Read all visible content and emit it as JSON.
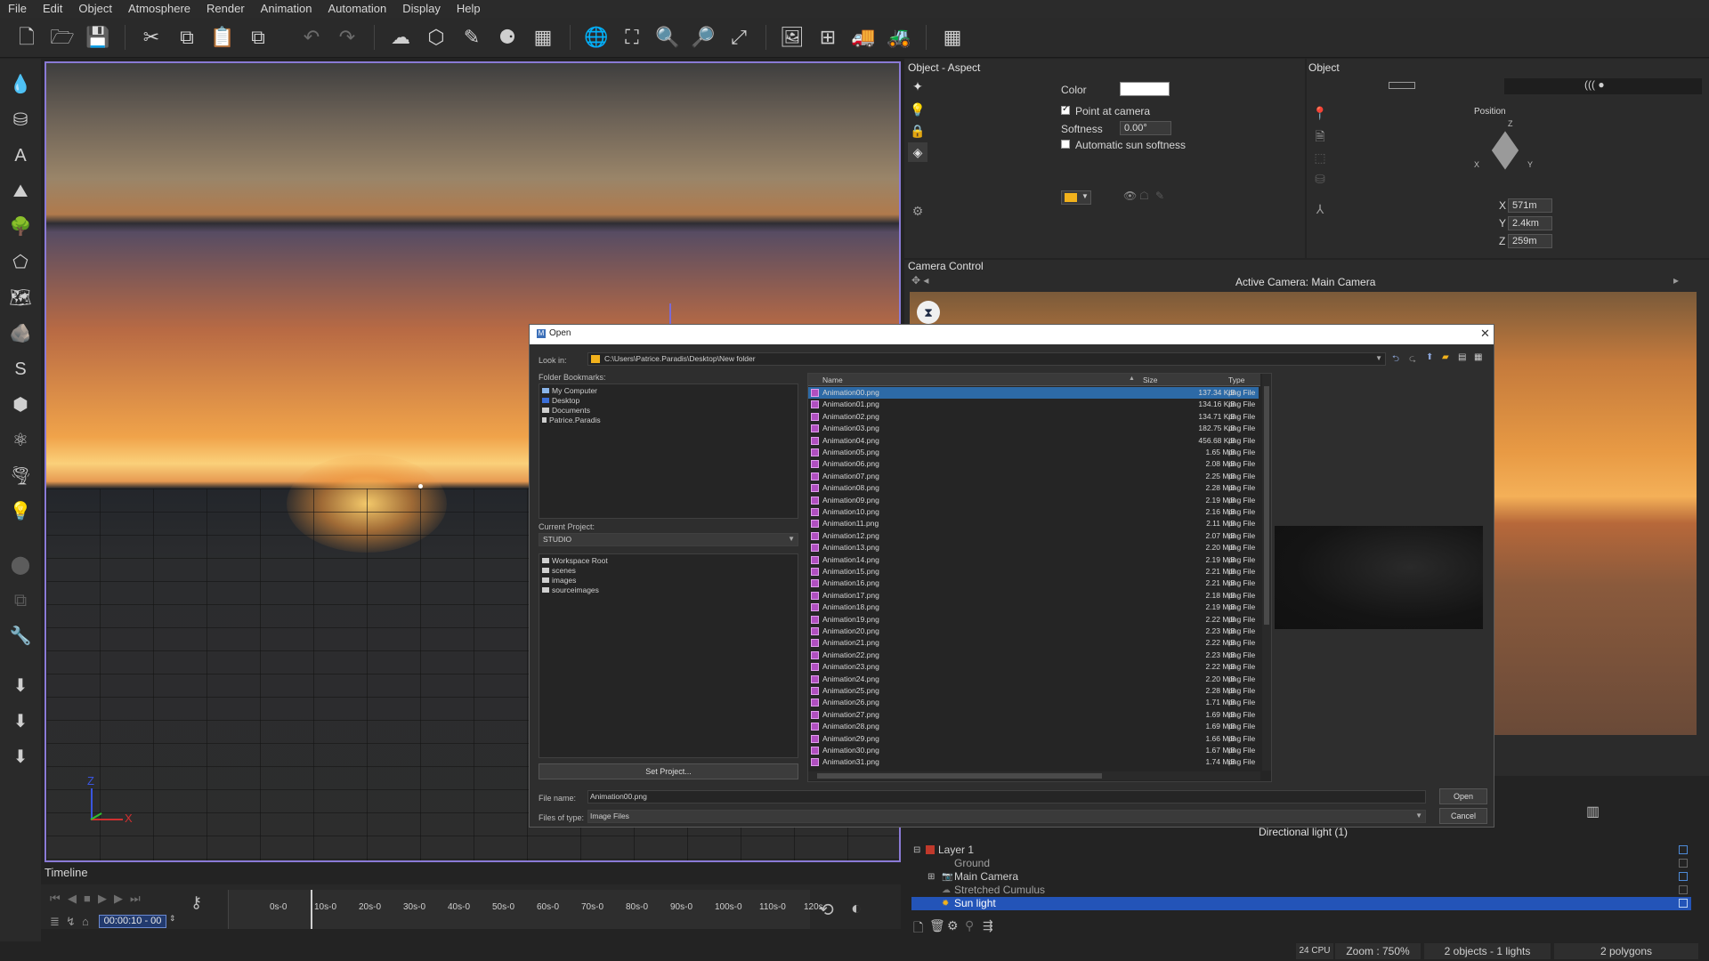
{
  "menu": [
    "File",
    "Edit",
    "Object",
    "Atmosphere",
    "Render",
    "Animation",
    "Automation",
    "Display",
    "Help"
  ],
  "toolbar": {
    "icons": [
      "new-file-icon",
      "open-file-icon",
      "save-icon",
      "cut-icon",
      "copy-icon",
      "paste-icon",
      "duplicate-icon",
      "undo-icon",
      "redo-icon",
      "atmosphere-icon",
      "object-icon",
      "plant-icon",
      "material-icon",
      "grid-icon",
      "globe-icon",
      "fit-icon",
      "zoom-in-icon",
      "zoom-out-icon",
      "maximize-icon",
      "render-area-icon",
      "render-frame-icon",
      "npr-icon",
      "render-icon",
      "layout-icon"
    ],
    "glyphs": [
      "🗋",
      "🗁",
      "💾",
      "✂",
      "⧉",
      "📋",
      "⧉",
      "↶",
      "↷",
      "☁",
      "⬡",
      "✎",
      "⚈",
      "▦",
      "🌐",
      "⛶",
      "🔍",
      "🔎",
      "⤢",
      "🖼",
      "⊞",
      "🚚",
      "🚜",
      "▦"
    ]
  },
  "left_toolbar": [
    "💧",
    "⛁",
    "A",
    "⛰",
    "🌳",
    "⬠",
    "🗺",
    "🪨",
    "S",
    "⬢",
    "⚛",
    "🌪",
    "💡",
    "⬤",
    "⧉",
    "🔧",
    "⬇",
    "⬇",
    "⬇"
  ],
  "viewport": {
    "axis_z": "Z",
    "axis_x": "X"
  },
  "timeline": {
    "title": "Timeline",
    "time_value": "00:00:10 - 00",
    "ticks": [
      "0s-0",
      "10s-0",
      "20s-0",
      "30s-0",
      "40s-0",
      "50s-0",
      "60s-0",
      "70s-0",
      "80s-0",
      "90s-0",
      "100s-0",
      "110s-0",
      "120s"
    ]
  },
  "object_aspect": {
    "title": "Object - Aspect",
    "color_label": "Color",
    "color_value": "#ffffff",
    "point_at_camera": "Point at camera",
    "softness_label": "Softness",
    "softness_value": "0.00°",
    "auto_sun_softness": "Automatic sun softness",
    "swatch_color": "#f2b21c"
  },
  "object_panel": {
    "title": "Object",
    "position_label": "Position",
    "x_label": "X",
    "x_value": "571m",
    "y_label": "Y",
    "y_value": "2.4km",
    "z_label": "Z",
    "z_value": "259m",
    "gizmo_z": "Z",
    "gizmo_x": "X",
    "gizmo_y": "Y"
  },
  "camera_control": {
    "title": "Camera Control",
    "active_camera": "Active Camera: Main Camera"
  },
  "dialog": {
    "title": "Open",
    "look_in_label": "Look in:",
    "look_in_path": "C:\\Users\\Patrice.Paradis\\Desktop\\New folder",
    "folder_bookmarks_label": "Folder Bookmarks:",
    "bookmarks": [
      "My Computer",
      "Desktop",
      "Documents",
      "Patrice.Paradis"
    ],
    "current_project_label": "Current Project:",
    "current_project_value": "STUDIO",
    "project_folders": [
      "Workspace Root",
      "scenes",
      "images",
      "sourceimages"
    ],
    "set_project_button": "Set Project...",
    "columns": {
      "name": "Name",
      "size": "Size",
      "type": "Type"
    },
    "files": [
      {
        "name": "Animation00.png",
        "size": "137.34 KiB",
        "type": "png File"
      },
      {
        "name": "Animation01.png",
        "size": "134.16 KiB",
        "type": "png File"
      },
      {
        "name": "Animation02.png",
        "size": "134.71 KiB",
        "type": "png File"
      },
      {
        "name": "Animation03.png",
        "size": "182.75 KiB",
        "type": "png File"
      },
      {
        "name": "Animation04.png",
        "size": "456.68 KiB",
        "type": "png File"
      },
      {
        "name": "Animation05.png",
        "size": "1.65 MiB",
        "type": "png File"
      },
      {
        "name": "Animation06.png",
        "size": "2.08 MiB",
        "type": "png File"
      },
      {
        "name": "Animation07.png",
        "size": "2.25 MiB",
        "type": "png File"
      },
      {
        "name": "Animation08.png",
        "size": "2.28 MiB",
        "type": "png File"
      },
      {
        "name": "Animation09.png",
        "size": "2.19 MiB",
        "type": "png File"
      },
      {
        "name": "Animation10.png",
        "size": "2.16 MiB",
        "type": "png File"
      },
      {
        "name": "Animation11.png",
        "size": "2.11 MiB",
        "type": "png File"
      },
      {
        "name": "Animation12.png",
        "size": "2.07 MiB",
        "type": "png File"
      },
      {
        "name": "Animation13.png",
        "size": "2.20 MiB",
        "type": "png File"
      },
      {
        "name": "Animation14.png",
        "size": "2.19 MiB",
        "type": "png File"
      },
      {
        "name": "Animation15.png",
        "size": "2.21 MiB",
        "type": "png File"
      },
      {
        "name": "Animation16.png",
        "size": "2.21 MiB",
        "type": "png File"
      },
      {
        "name": "Animation17.png",
        "size": "2.18 MiB",
        "type": "png File"
      },
      {
        "name": "Animation18.png",
        "size": "2.19 MiB",
        "type": "png File"
      },
      {
        "name": "Animation19.png",
        "size": "2.22 MiB",
        "type": "png File"
      },
      {
        "name": "Animation20.png",
        "size": "2.23 MiB",
        "type": "png File"
      },
      {
        "name": "Animation21.png",
        "size": "2.22 MiB",
        "type": "png File"
      },
      {
        "name": "Animation22.png",
        "size": "2.23 MiB",
        "type": "png File"
      },
      {
        "name": "Animation23.png",
        "size": "2.22 MiB",
        "type": "png File"
      },
      {
        "name": "Animation24.png",
        "size": "2.20 MiB",
        "type": "png File"
      },
      {
        "name": "Animation25.png",
        "size": "2.28 MiB",
        "type": "png File"
      },
      {
        "name": "Animation26.png",
        "size": "1.71 MiB",
        "type": "png File"
      },
      {
        "name": "Animation27.png",
        "size": "1.69 MiB",
        "type": "png File"
      },
      {
        "name": "Animation28.png",
        "size": "1.69 MiB",
        "type": "png File"
      },
      {
        "name": "Animation29.png",
        "size": "1.66 MiB",
        "type": "png File"
      },
      {
        "name": "Animation30.png",
        "size": "1.67 MiB",
        "type": "png File"
      },
      {
        "name": "Animation31.png",
        "size": "1.74 MiB",
        "type": "png File"
      }
    ],
    "file_name_label": "File name:",
    "file_name_value": "Animation00.png",
    "files_of_type_label": "Files of type:",
    "files_of_type_value": "Image Files",
    "open_button": "Open",
    "cancel_button": "Cancel"
  },
  "scene": {
    "header": "Directional light (1)",
    "items": [
      "Layer 1",
      "Ground",
      "Main Camera",
      "Stretched Cumulus",
      "Sun light"
    ]
  },
  "status": {
    "cpu": "24 CPU",
    "zoom": "Zoom : 750%",
    "objects": "2 objects - 1 lights",
    "polygons": "2 polygons"
  }
}
